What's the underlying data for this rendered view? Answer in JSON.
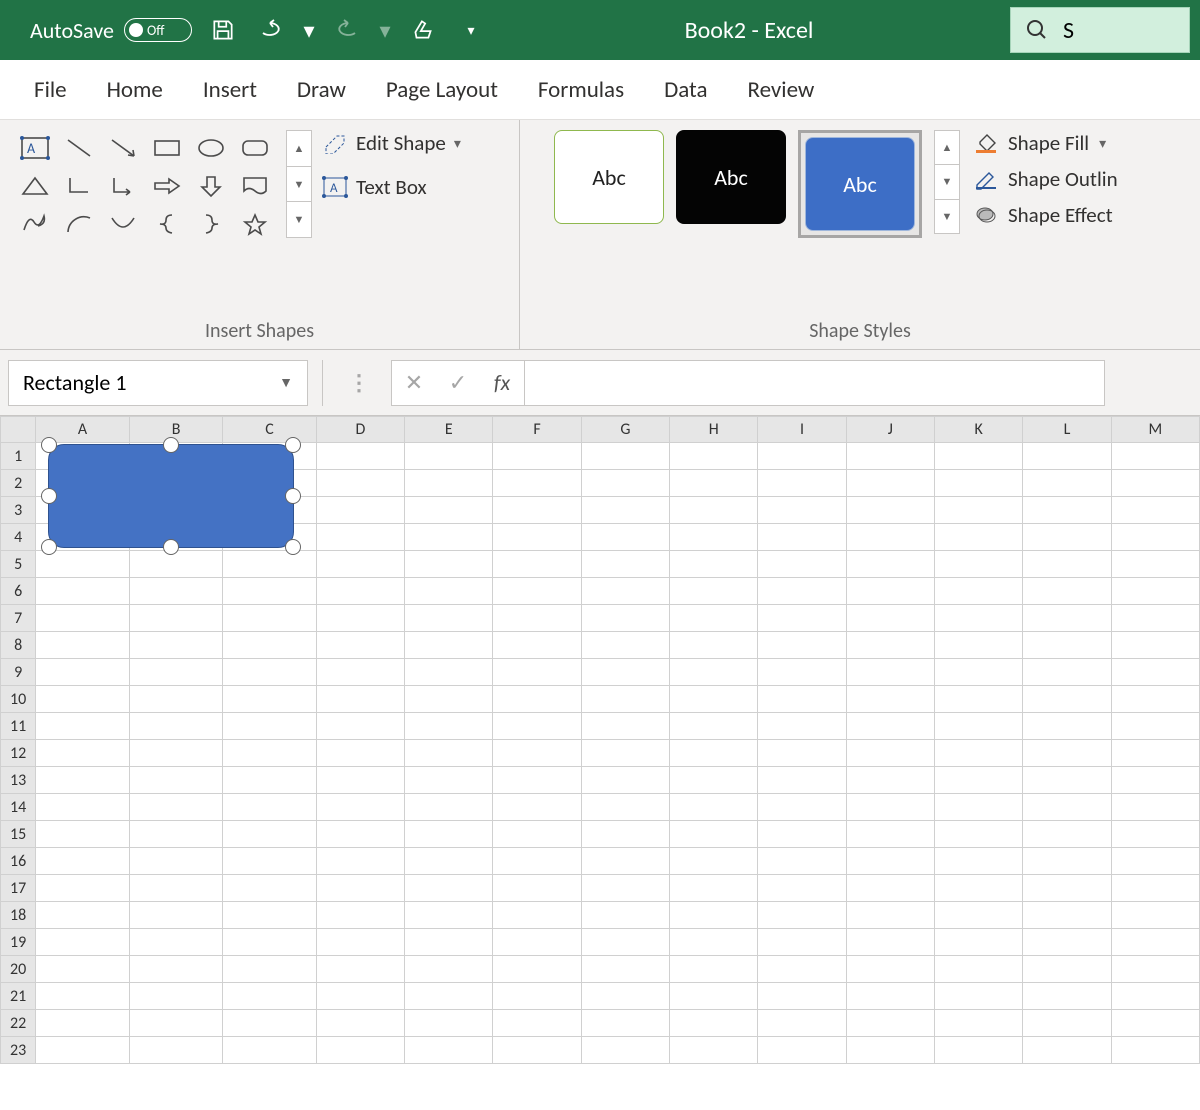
{
  "titlebar": {
    "autosave_label": "AutoSave",
    "autosave_state": "Off",
    "document_title": "Book2  -  Excel",
    "search_hint": "S"
  },
  "tabs": [
    "File",
    "Home",
    "Insert",
    "Draw",
    "Page Layout",
    "Formulas",
    "Data",
    "Review"
  ],
  "ribbon": {
    "insert_shapes_label": "Insert Shapes",
    "edit_shape": "Edit Shape",
    "text_box": "Text Box",
    "shape_styles_label": "Shape Styles",
    "style_preview_text": "Abc",
    "shape_fill": "Shape Fill",
    "shape_outline": "Shape Outlin",
    "shape_effects": "Shape Effect"
  },
  "formula_bar": {
    "name_box": "Rectangle 1",
    "fx_label": "fx",
    "formula": ""
  },
  "grid": {
    "columns": [
      "A",
      "B",
      "C",
      "D",
      "E",
      "F",
      "G",
      "H",
      "I",
      "J",
      "K",
      "L",
      "M"
    ],
    "rows": [
      1,
      2,
      3,
      4,
      5,
      6,
      7,
      8,
      9,
      10,
      11,
      12,
      13,
      14,
      15,
      16,
      17,
      18,
      19,
      20,
      21,
      22,
      23
    ]
  },
  "selected_shape": "Rectangle 1"
}
